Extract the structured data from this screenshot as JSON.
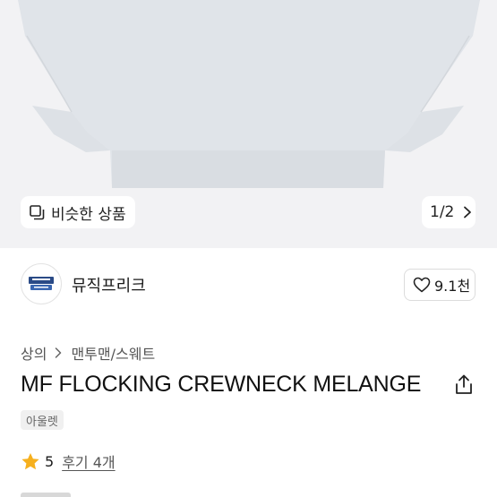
{
  "hero": {
    "similar_label": "비슷한 상품",
    "page_indicator": "1/2"
  },
  "shop": {
    "name": "뮤직프리크",
    "likes": "9.1천"
  },
  "breadcrumb": {
    "level1": "상의",
    "level2": "맨투맨/스웨트"
  },
  "product": {
    "title": "MF FLOCKING CREWNECK MELANGE",
    "tag": "아울렛",
    "rating": "5",
    "reviews": "후기 4개"
  },
  "colors": {
    "star": "#f6b01e",
    "hero_bg": "#f2f2f4",
    "sweater": "#dfe3e8"
  }
}
